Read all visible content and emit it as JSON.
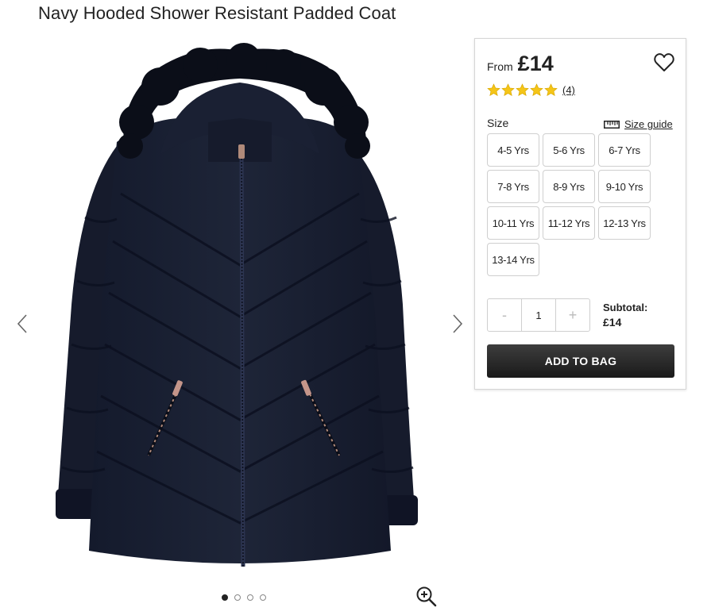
{
  "product": {
    "title": "Navy Hooded Shower Resistant Padded Coat"
  },
  "gallery": {
    "image_icon": "navy-padded-coat-image",
    "prev_icon": "chevron-left-icon",
    "next_icon": "chevron-right-icon",
    "zoom_icon": "zoom-in-icon",
    "slide_count": 4,
    "active_slide": 1
  },
  "purchase": {
    "from_label": "From",
    "price": "£14",
    "wishlist_icon": "heart-icon",
    "rating": {
      "stars": 5,
      "star_color": "#f5c518",
      "review_count": "(4)"
    },
    "size_label": "Size",
    "size_guide": {
      "icon": "ruler-icon",
      "label": "Size guide"
    },
    "sizes": [
      "4-5 Yrs",
      "5-6 Yrs",
      "6-7 Yrs",
      "7-8 Yrs",
      "8-9 Yrs",
      "9-10 Yrs",
      "10-11 Yrs",
      "11-12 Yrs",
      "12-13 Yrs",
      "13-14 Yrs"
    ],
    "quantity": {
      "minus": "-",
      "value": "1",
      "plus": "+"
    },
    "subtotal_label": "Subtotal:",
    "subtotal_value": "£14",
    "add_to_bag": "ADD TO BAG",
    "button_color": "#222222"
  }
}
